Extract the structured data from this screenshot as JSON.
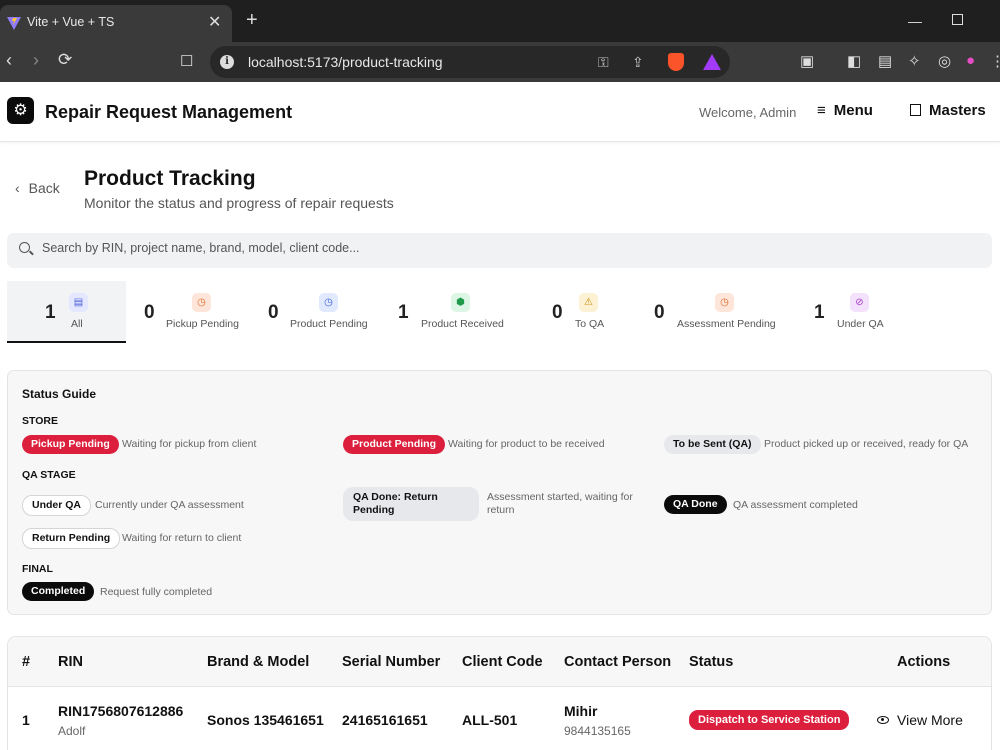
{
  "browser": {
    "tab_title": "Vite + Vue + TS",
    "tab_close": "✕",
    "new_tab": "+",
    "url": "localhost:5173/product-tracking",
    "window_min": "—"
  },
  "header": {
    "title": "Repair Request Management",
    "welcome": "Welcome, Admin",
    "menu_label": "Menu",
    "masters_label": "Masters"
  },
  "page": {
    "back_label": "Back",
    "title": "Product Tracking",
    "subtitle": "Monitor the status and progress of repair requests"
  },
  "search": {
    "placeholder": "Search by RIN, project name, brand, model, client code...",
    "value": ""
  },
  "status_tabs": [
    {
      "count": "1",
      "label": "All",
      "icon": "document-icon",
      "color": "#4a5dd6",
      "bg": "#e4e8ff"
    },
    {
      "count": "0",
      "label": "Pickup Pending",
      "icon": "clock-icon",
      "color": "#e06a2b",
      "bg": "#fde6d9"
    },
    {
      "count": "0",
      "label": "Product Pending",
      "icon": "clock-icon",
      "color": "#3c62d6",
      "bg": "#e1e9ff"
    },
    {
      "count": "1",
      "label": "Product Received",
      "icon": "package-icon",
      "color": "#1e9a4a",
      "bg": "#dcf5e4"
    },
    {
      "count": "0",
      "label": "To QA",
      "icon": "warning-icon",
      "color": "#c98a06",
      "bg": "#fcf1d2"
    },
    {
      "count": "0",
      "label": "Assessment Pending",
      "icon": "clock-icon",
      "color": "#e06a2b",
      "bg": "#fde6d9"
    },
    {
      "count": "1",
      "label": "Under QA",
      "icon": "check-circle-icon",
      "color": "#a239c9",
      "bg": "#f4e1fb"
    }
  ],
  "guide": {
    "title": "Status Guide",
    "sections": [
      "STORE",
      "QA STAGE",
      "FINAL"
    ],
    "items": [
      {
        "badge": "Pickup Pending",
        "desc": "Waiting for pickup from client"
      },
      {
        "badge": "Product Pending",
        "desc": "Waiting for product to be received"
      },
      {
        "badge": "To be Sent (QA)",
        "desc": "Product picked up or received, ready for QA"
      },
      {
        "badge": "Under QA",
        "desc": "Currently under QA assessment"
      },
      {
        "badge": "QA Done: Return Pending",
        "desc": "Assessment started, waiting for return"
      },
      {
        "badge": "QA Done",
        "desc": "QA assessment completed"
      },
      {
        "badge": "Return Pending",
        "desc": "Waiting for return to client"
      },
      {
        "badge": "Completed",
        "desc": "Request fully completed"
      }
    ]
  },
  "table": {
    "headers": [
      "#",
      "RIN",
      "Brand & Model",
      "Serial Number",
      "Client Code",
      "Contact Person",
      "Status",
      "Actions"
    ],
    "rows": [
      {
        "num": "1",
        "rin": "RIN1756807612886",
        "rin_sub": "Adolf",
        "brand_model": "Sonos 135461651",
        "serial": "24165161651",
        "client_code": "ALL-501",
        "contact": "Mihir",
        "contact_phone": "9844135165",
        "status": "Dispatch to Service Station",
        "action": "View More"
      }
    ]
  }
}
